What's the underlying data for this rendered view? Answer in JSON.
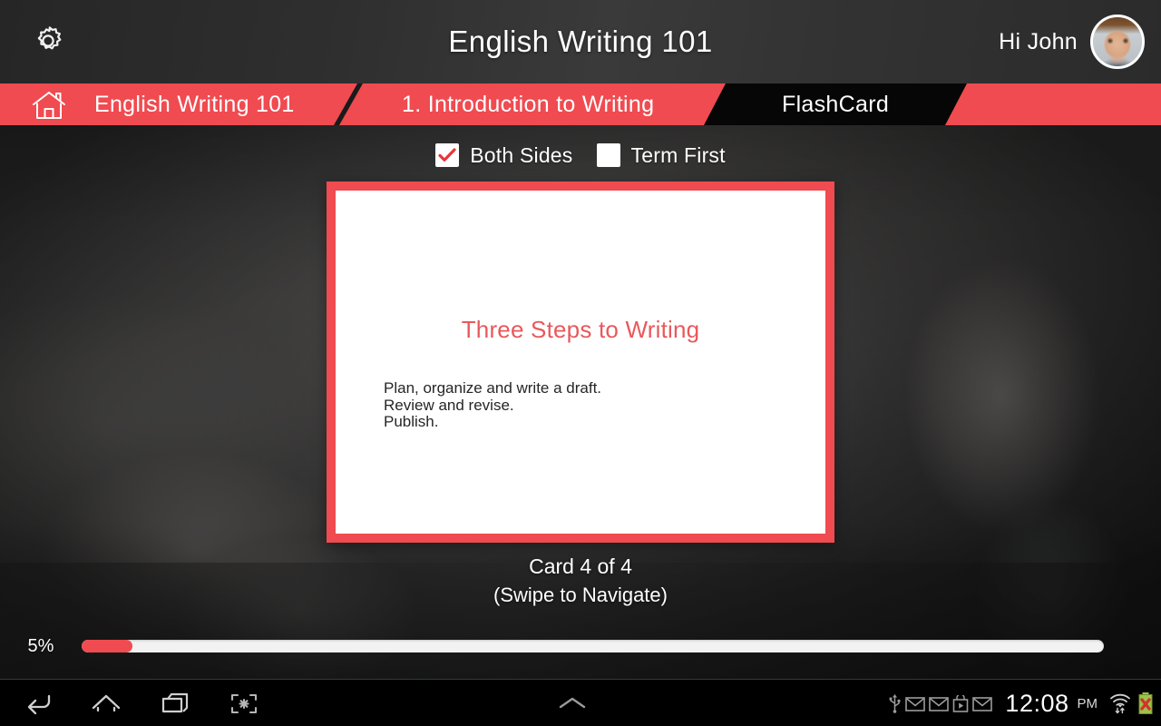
{
  "header": {
    "title": "English Writing 101",
    "greeting": "Hi John",
    "gear_icon": "gear-icon",
    "avatar_icon": "user-avatar"
  },
  "breadcrumb": {
    "home_icon": "home-icon",
    "items": [
      {
        "label": "English Writing 101",
        "active": false
      },
      {
        "label": "1. Introduction to Writing",
        "active": false
      },
      {
        "label": "FlashCard",
        "active": true
      }
    ]
  },
  "options": [
    {
      "label": "Both Sides",
      "checked": true
    },
    {
      "label": "Term First",
      "checked": false
    }
  ],
  "card": {
    "title": "Three Steps to Writing",
    "lines": [
      "Plan, organize and write a draft.",
      "Review and revise.",
      "Publish."
    ],
    "caption_main": "Card 4 of 4",
    "caption_sub": "(Swipe to Navigate)"
  },
  "progress": {
    "percent_label": "5%",
    "percent_value": 5
  },
  "system_bar": {
    "nav": [
      {
        "name": "back-icon"
      },
      {
        "name": "home-icon"
      },
      {
        "name": "recents-icon"
      },
      {
        "name": "screenshot-icon"
      }
    ],
    "center_icon": "chevron-up-icon",
    "status_icons": [
      "usb-icon",
      "gmail-icon",
      "gmail-icon",
      "play-store-icon",
      "gmail-icon"
    ],
    "clock": "12:08",
    "ampm": "PM",
    "wifi_icon": "wifi-icon",
    "battery_icon": "battery-error-icon"
  },
  "colors": {
    "accent_red": "#ef4b50",
    "card_title_red": "#e8595c",
    "header_dark": "#2f2f2f",
    "crumb_black": "#060606"
  }
}
